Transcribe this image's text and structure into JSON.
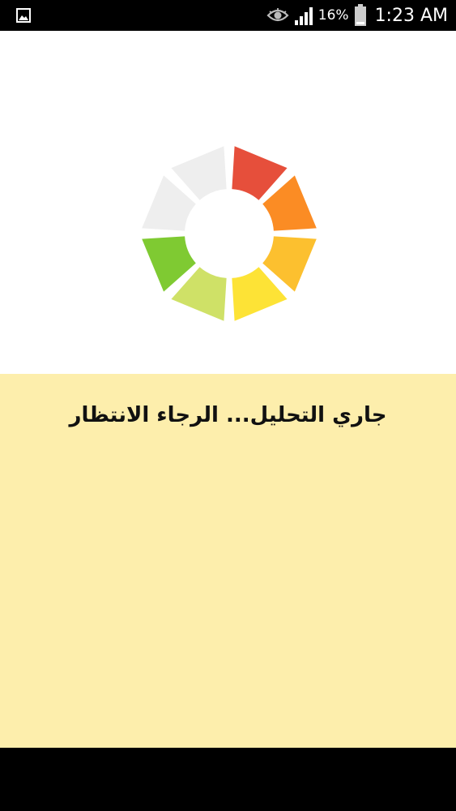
{
  "status_bar": {
    "icons": [
      "gallery-icon",
      "eye-icon",
      "signal-icon",
      "battery-icon"
    ],
    "battery": "16%",
    "time": "1:23 AM"
  },
  "loader": {
    "message": "جاري التحليل... الرجاء الانتظار",
    "segment_colors": [
      "#e64f3b",
      "#fb8c24",
      "#fcc02f",
      "#fde336",
      "#cfe167",
      "#7fca32",
      "#eeeeee",
      "#eeeeee"
    ]
  },
  "colors": {
    "top_panel_bg": "#ffffff",
    "bottom_panel_bg": "#fdeeac",
    "bars": "#000000"
  }
}
